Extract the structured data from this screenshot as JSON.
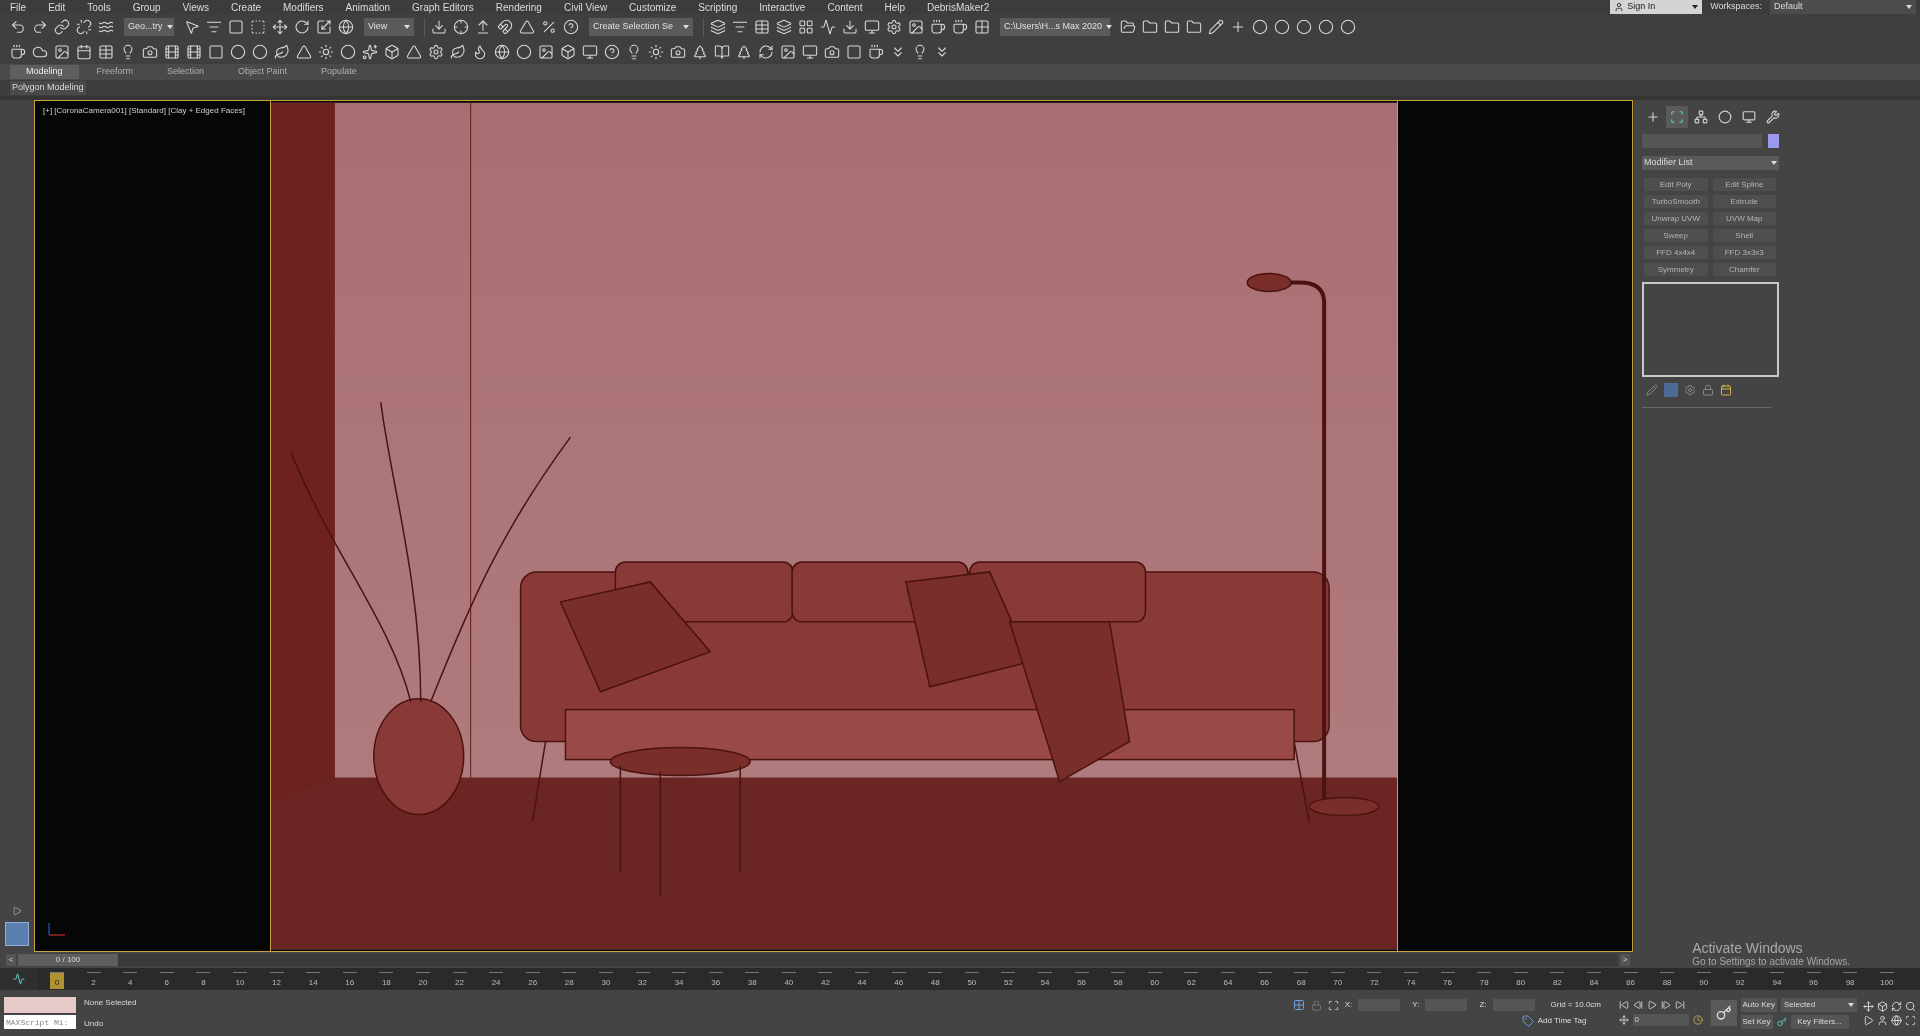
{
  "menu": [
    "File",
    "Edit",
    "Tools",
    "Group",
    "Views",
    "Create",
    "Modifiers",
    "Animation",
    "Graph Editors",
    "Rendering",
    "Civil View",
    "Customize",
    "Scripting",
    "Interactive",
    "Content",
    "Help",
    "DebrisMaker2"
  ],
  "account": {
    "sign_in": "Sign In",
    "workspaces_label": "Workspaces:",
    "workspace": "Default"
  },
  "toolbar": {
    "selection_filter": "Geo...try",
    "reference_coord": "View",
    "named_selection": "Create Selection Se",
    "project_path": "C:\\Users\\H...s Max 2020"
  },
  "ribbon": {
    "tabs": [
      {
        "label": "Modeling",
        "selected": true
      },
      {
        "label": "Freeform",
        "selected": false
      },
      {
        "label": "Selection",
        "selected": false
      },
      {
        "label": "Object Paint",
        "selected": false
      },
      {
        "label": "Populate",
        "selected": false
      }
    ],
    "panel": "Polygon Modeling"
  },
  "viewport": {
    "label": "[+] [CoronaCamera001] [Standard] [Clay + Edged Faces]"
  },
  "command_panel": {
    "tabs": [
      {
        "kind": "create",
        "selected": false
      },
      {
        "kind": "modify",
        "selected": true
      },
      {
        "kind": "hierarchy",
        "selected": false
      },
      {
        "kind": "motion",
        "selected": false
      },
      {
        "kind": "display",
        "selected": false
      },
      {
        "kind": "utilities",
        "selected": false
      }
    ],
    "modifier_list": "Modifier List",
    "modifier_buttons": [
      {
        "label": "Edit Poly",
        "disabled": true
      },
      {
        "label": "Edit Spline",
        "disabled": true
      },
      {
        "label": "TurboSmooth",
        "disabled": true
      },
      {
        "label": "Extrude",
        "disabled": true
      },
      {
        "label": "Unwrap UVW",
        "disabled": true
      },
      {
        "label": "UVW Map",
        "disabled": true
      },
      {
        "label": "Sweep",
        "disabled": true
      },
      {
        "label": "Shell",
        "disabled": true
      },
      {
        "label": "FFD 4x4x4",
        "disabled": true
      },
      {
        "label": "FFD 3x3x3",
        "disabled": true
      },
      {
        "label": "Symmetry",
        "disabled": true
      },
      {
        "label": "Chamfer",
        "disabled": true
      }
    ]
  },
  "timeline": {
    "prev": "<",
    "position": "0 / 100",
    "level": 0,
    "next": ">",
    "ticks": [
      "0",
      "2",
      "4",
      "6",
      "8",
      "10",
      "12",
      "14",
      "16",
      "18",
      "20",
      "22",
      "24",
      "26",
      "28",
      "30",
      "32",
      "34",
      "36",
      "38",
      "40",
      "42",
      "44",
      "46",
      "48",
      "50",
      "52",
      "54",
      "56",
      "58",
      "60",
      "62",
      "64",
      "66",
      "68",
      "70",
      "72",
      "74",
      "76",
      "78",
      "80",
      "82",
      "84",
      "86",
      "88",
      "90",
      "92",
      "94",
      "96",
      "98",
      "100"
    ]
  },
  "status": {
    "maxscript_placeholder": "MAXScript Mi:",
    "selection": "None Selected",
    "prompt": "Undo",
    "x_label": "X:",
    "y_label": "Y:",
    "z_label": "Z:",
    "grid": "Grid = 10.0cm",
    "add_time_tag": "Add Time Tag",
    "auto_key": "Auto Key",
    "key_mode": "Selected",
    "set_key": "Set Key",
    "key_filters": "Key Filters...",
    "frame": "0"
  },
  "os_notice": {
    "title": "Activate Windows",
    "text": "Go to Settings to activate Windows."
  }
}
